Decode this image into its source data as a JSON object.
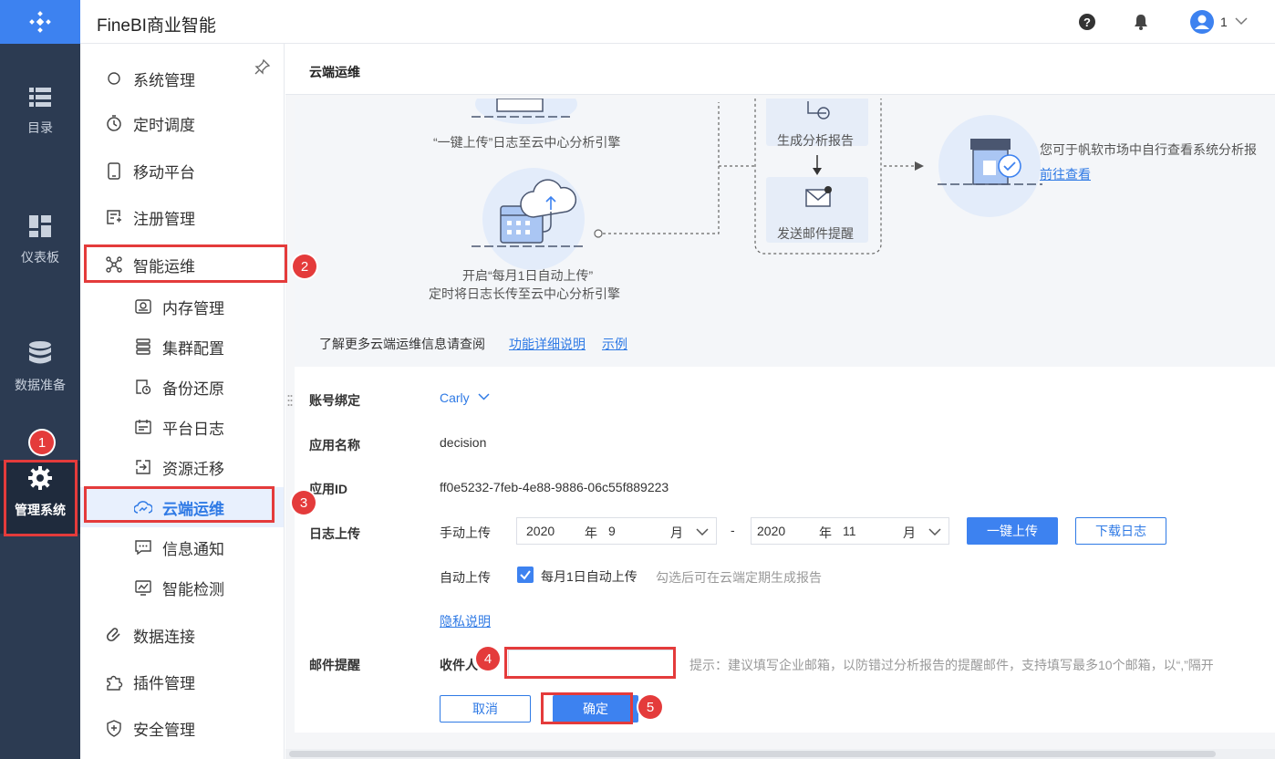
{
  "app": {
    "title": "FineBI商业智能",
    "user": "1"
  },
  "rail": [
    {
      "label": "目录",
      "icon": "list-icon"
    },
    {
      "label": "仪表板",
      "icon": "dashboard-icon"
    },
    {
      "label": "数据准备",
      "icon": "database-icon"
    },
    {
      "label": "管理系统",
      "icon": "gear-icon"
    }
  ],
  "nav": {
    "partial_top": "系统管理",
    "items": [
      {
        "label": "定时调度"
      },
      {
        "label": "移动平台"
      },
      {
        "label": "注册管理"
      },
      {
        "label": "智能运维"
      },
      {
        "label": "内存管理"
      },
      {
        "label": "集群配置"
      },
      {
        "label": "备份还原"
      },
      {
        "label": "平台日志"
      },
      {
        "label": "资源迁移"
      },
      {
        "label": "云端运维"
      },
      {
        "label": "信息通知"
      },
      {
        "label": "智能检测"
      },
      {
        "label": "数据连接"
      },
      {
        "label": "插件管理"
      },
      {
        "label": "安全管理"
      }
    ]
  },
  "page": {
    "title": "云端运维"
  },
  "intro": {
    "step_upload": "“一键上传”日志至云中心分析引擎",
    "step_auto_1": "开启“每月1日自动上传”",
    "step_auto_2": "定时将日志长传至云中心分析引擎",
    "gen_report": "生成分析报告",
    "send_mail": "发送邮件提醒",
    "market_text": "您可于帆软市场中自行查看系统分析报",
    "market_link": "前往查看",
    "more_text": "了解更多云端运维信息请查阅",
    "link_detail": "功能详细说明",
    "link_example": "示例"
  },
  "form": {
    "account_label": "账号绑定",
    "account_value": "Carly",
    "app_name_label": "应用名称",
    "app_name_value": "decision",
    "app_id_label": "应用ID",
    "app_id_value": "ff0e5232-7feb-4e88-9886-06c55f889223",
    "log_upload_label": "日志上传",
    "manual_label": "手动上传",
    "from_year": "2020",
    "from_month": "9",
    "to_year": "2020",
    "to_month": "11",
    "year_unit": "年",
    "month_unit": "月",
    "range_sep": "-",
    "upload_btn": "一键上传",
    "download_btn": "下载日志",
    "auto_label": "自动上传",
    "auto_checkbox": "每月1日自动上传",
    "auto_hint": "勾选后可在云端定期生成报告",
    "privacy_link": "隐私说明",
    "mail_label": "邮件提醒",
    "recipient_label": "收件人",
    "recipient_value": "",
    "recipient_hint": "提示：建议填写企业邮箱，以防错过分析报告的提醒邮件，支持填写最多10个邮箱，以“,”隔开",
    "cancel_btn": "取消",
    "confirm_btn": "确定"
  },
  "markers": [
    "1",
    "2",
    "3",
    "4",
    "5"
  ],
  "colors": {
    "accent": "#3d82f0",
    "rail": "#2c3b52",
    "highlight": "#e43b3b"
  }
}
